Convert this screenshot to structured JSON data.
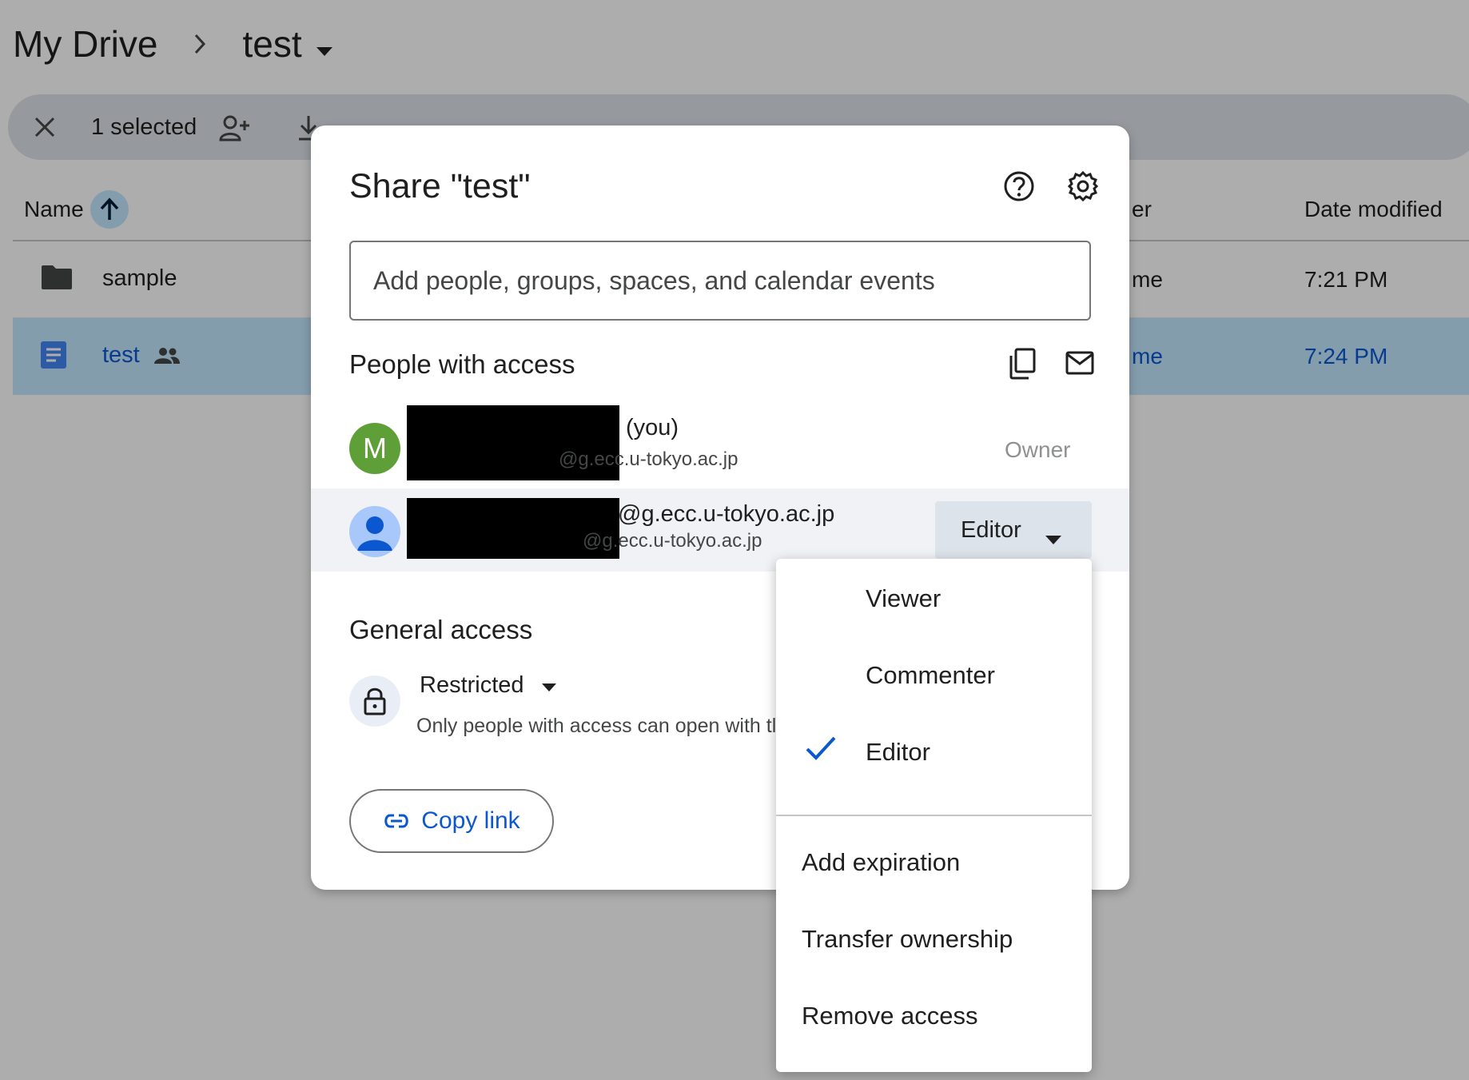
{
  "breadcrumb": {
    "root": "My Drive",
    "current": "test"
  },
  "selection_bar": {
    "count_label": "1 selected"
  },
  "columns": {
    "name": "Name",
    "owner": "er",
    "date_modified": "Date modified"
  },
  "files": [
    {
      "name": "sample",
      "owner": "me",
      "date": "7:21 PM",
      "type": "folder"
    },
    {
      "name": "test",
      "owner": "me",
      "date": "7:24 PM",
      "type": "document",
      "shared": true
    }
  ],
  "dialog": {
    "title": "Share \"test\"",
    "add_placeholder": "Add people, groups, spaces, and calendar events",
    "people_title": "People with access",
    "people": [
      {
        "initial": "M",
        "name_suffix": "(you)",
        "email_suffix": "@g.ecc.u-tokyo.ac.jp",
        "role": "Owner"
      },
      {
        "name_suffix": "@g.ecc.u-tokyo.ac.jp",
        "email_suffix": "@g.ecc.u-tokyo.ac.jp",
        "role": "Editor"
      }
    ],
    "general_access_title": "General access",
    "access_level": "Restricted",
    "access_desc": "Only people with access can open with tl",
    "copy_link_label": "Copy link"
  },
  "role_menu": {
    "roles": [
      "Viewer",
      "Commenter",
      "Editor"
    ],
    "selected": "Editor",
    "actions": [
      "Add expiration",
      "Transfer ownership",
      "Remove access"
    ]
  },
  "colors": {
    "accent": "#0b57d0",
    "selected_row": "#c2e7ff",
    "owner_avatar": "#5e9f37"
  }
}
